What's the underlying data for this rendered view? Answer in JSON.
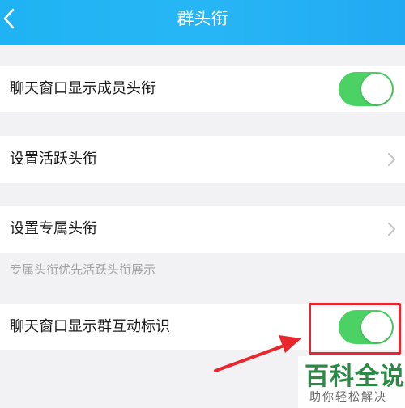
{
  "header": {
    "title": "群头衔",
    "back_icon": "chevron-left-icon"
  },
  "settings": [
    {
      "label": "聊天窗口显示成员头衔",
      "control": "toggle",
      "on": true
    },
    {
      "label": "设置活跃头衔",
      "control": "chevron"
    },
    {
      "label": "设置专属头衔",
      "control": "chevron"
    },
    {
      "label": "聊天窗口显示群互动标识",
      "control": "toggle",
      "on": true
    }
  ],
  "hint_text": "专属头衔优先活跃头衔展示",
  "watermark": {
    "main": "百科全说",
    "sub": "助你轻松解决"
  },
  "colors": {
    "header_blue": "#1fb3f3",
    "toggle_on": "#4cd264",
    "page_bg": "#f2f2f4",
    "annotation_red": "#e8262b",
    "watermark_green": "#2a8a45"
  }
}
